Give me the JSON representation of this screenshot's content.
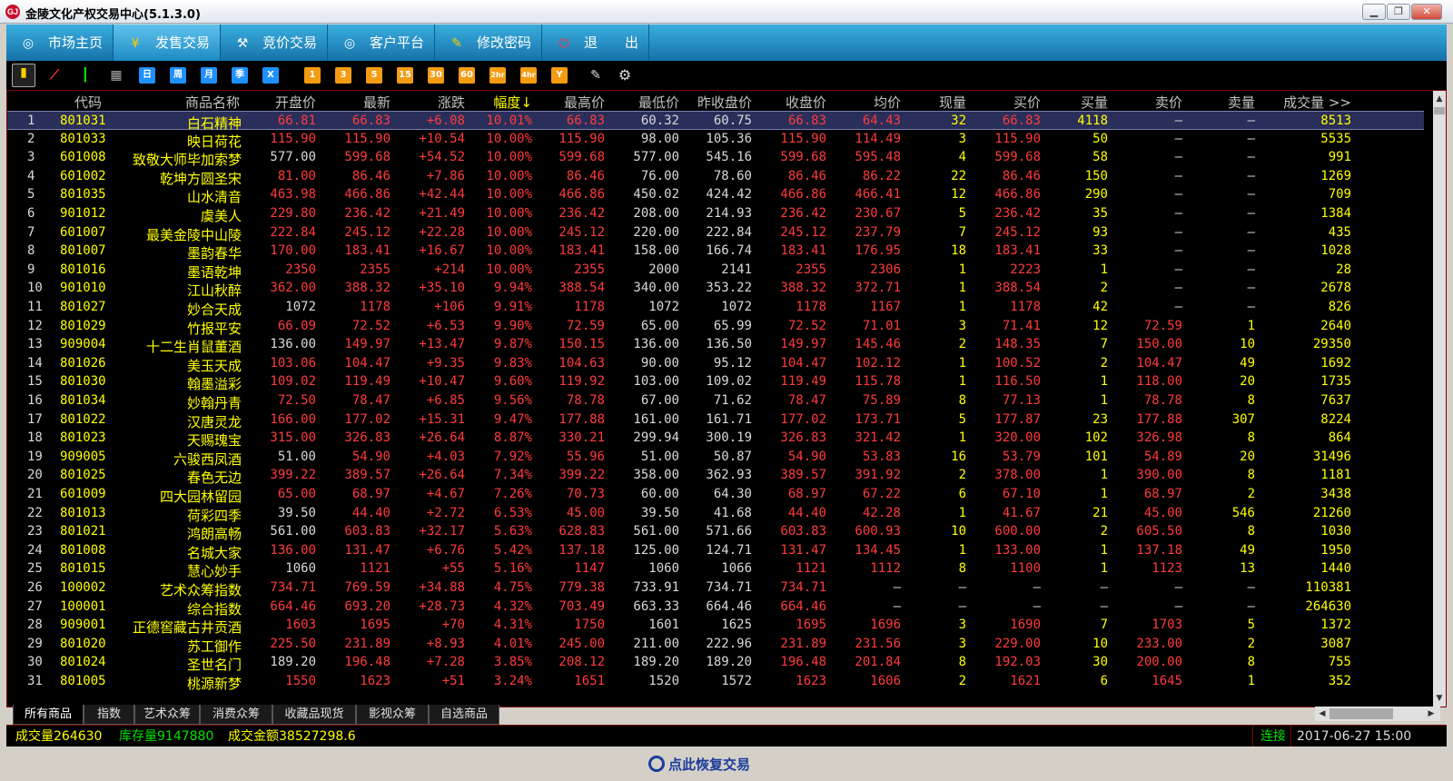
{
  "window": {
    "title": "金陵文化产权交易中心(5.1.3.0)",
    "logo": "GJ"
  },
  "nav": [
    {
      "label": "市场主页",
      "icon": "home-icon",
      "glyph": "◎"
    },
    {
      "label": "发售交易",
      "icon": "yuan-icon",
      "glyph": "¥"
    },
    {
      "label": "竞价交易",
      "icon": "auction-icon",
      "glyph": "⚒"
    },
    {
      "label": "客户平台",
      "icon": "client-icon",
      "glyph": "◎"
    },
    {
      "label": "修改密码",
      "icon": "key-icon",
      "glyph": "✎"
    },
    {
      "label": "退　　出",
      "icon": "power-icon",
      "glyph": "⏻"
    }
  ],
  "toolbar": {
    "periods": [
      "日",
      "周",
      "月",
      "季",
      "X"
    ],
    "minutes": [
      "1",
      "3",
      "5",
      "15",
      "30",
      "60",
      "2hr",
      "4hr",
      "Y"
    ]
  },
  "columns": [
    "代码",
    "商品名称",
    "开盘价",
    "最新",
    "涨跌",
    "幅度↓",
    "最高价",
    "最低价",
    "昨收盘价",
    "收盘价",
    "均价",
    "现量",
    "买价",
    "买量",
    "卖价",
    "卖量",
    "成交量 >>"
  ],
  "rows": [
    [
      "1",
      "801031",
      "白石精神",
      "66.81",
      "66.83",
      "+6.08",
      "10.01%",
      "66.83",
      "60.32",
      "60.75",
      "66.83",
      "64.43",
      "32",
      "66.83",
      "4118",
      "—",
      "—",
      "8513"
    ],
    [
      "2",
      "801033",
      "映日荷花",
      "115.90",
      "115.90",
      "+10.54",
      "10.00%",
      "115.90",
      "98.00",
      "105.36",
      "115.90",
      "114.49",
      "3",
      "115.90",
      "50",
      "—",
      "—",
      "5535"
    ],
    [
      "3",
      "601008",
      "致敬大师毕加索梦",
      "577.00",
      "599.68",
      "+54.52",
      "10.00%",
      "599.68",
      "577.00",
      "545.16",
      "599.68",
      "595.48",
      "4",
      "599.68",
      "58",
      "—",
      "—",
      "991"
    ],
    [
      "4",
      "601002",
      "乾坤方圆圣宋",
      "81.00",
      "86.46",
      "+7.86",
      "10.00%",
      "86.46",
      "76.00",
      "78.60",
      "86.46",
      "86.22",
      "22",
      "86.46",
      "150",
      "—",
      "—",
      "1269"
    ],
    [
      "5",
      "801035",
      "山水清音",
      "463.98",
      "466.86",
      "+42.44",
      "10.00%",
      "466.86",
      "450.02",
      "424.42",
      "466.86",
      "466.41",
      "12",
      "466.86",
      "290",
      "—",
      "—",
      "709"
    ],
    [
      "6",
      "901012",
      "虞美人",
      "229.80",
      "236.42",
      "+21.49",
      "10.00%",
      "236.42",
      "208.00",
      "214.93",
      "236.42",
      "230.67",
      "5",
      "236.42",
      "35",
      "—",
      "—",
      "1384"
    ],
    [
      "7",
      "601007",
      "最美金陵中山陵",
      "222.84",
      "245.12",
      "+22.28",
      "10.00%",
      "245.12",
      "220.00",
      "222.84",
      "245.12",
      "237.79",
      "7",
      "245.12",
      "93",
      "—",
      "—",
      "435"
    ],
    [
      "8",
      "801007",
      "墨韵春华",
      "170.00",
      "183.41",
      "+16.67",
      "10.00%",
      "183.41",
      "158.00",
      "166.74",
      "183.41",
      "176.95",
      "18",
      "183.41",
      "33",
      "—",
      "—",
      "1028"
    ],
    [
      "9",
      "801016",
      "墨语乾坤",
      "2350",
      "2355",
      "+214",
      "10.00%",
      "2355",
      "2000",
      "2141",
      "2355",
      "2306",
      "1",
      "2223",
      "1",
      "—",
      "—",
      "28"
    ],
    [
      "10",
      "901010",
      "江山秋醉",
      "362.00",
      "388.32",
      "+35.10",
      "9.94%",
      "388.54",
      "340.00",
      "353.22",
      "388.32",
      "372.71",
      "1",
      "388.54",
      "2",
      "—",
      "—",
      "2678"
    ],
    [
      "11",
      "801027",
      "妙合天成",
      "1072",
      "1178",
      "+106",
      "9.91%",
      "1178",
      "1072",
      "1072",
      "1178",
      "1167",
      "1",
      "1178",
      "42",
      "—",
      "—",
      "826"
    ],
    [
      "12",
      "801029",
      "竹报平安",
      "66.09",
      "72.52",
      "+6.53",
      "9.90%",
      "72.59",
      "65.00",
      "65.99",
      "72.52",
      "71.01",
      "3",
      "71.41",
      "12",
      "72.59",
      "1",
      "2640"
    ],
    [
      "13",
      "909004",
      "十二生肖鼠董酒",
      "136.00",
      "149.97",
      "+13.47",
      "9.87%",
      "150.15",
      "136.00",
      "136.50",
      "149.97",
      "145.46",
      "2",
      "148.35",
      "7",
      "150.00",
      "10",
      "29350"
    ],
    [
      "14",
      "801026",
      "美玉天成",
      "103.06",
      "104.47",
      "+9.35",
      "9.83%",
      "104.63",
      "90.00",
      "95.12",
      "104.47",
      "102.12",
      "1",
      "100.52",
      "2",
      "104.47",
      "49",
      "1692"
    ],
    [
      "15",
      "801030",
      "翰墨溢彩",
      "109.02",
      "119.49",
      "+10.47",
      "9.60%",
      "119.92",
      "103.00",
      "109.02",
      "119.49",
      "115.78",
      "1",
      "116.50",
      "1",
      "118.00",
      "20",
      "1735"
    ],
    [
      "16",
      "801034",
      "妙翰丹青",
      "72.50",
      "78.47",
      "+6.85",
      "9.56%",
      "78.78",
      "67.00",
      "71.62",
      "78.47",
      "75.89",
      "8",
      "77.13",
      "1",
      "78.78",
      "8",
      "7637"
    ],
    [
      "17",
      "801022",
      "汉唐灵龙",
      "166.00",
      "177.02",
      "+15.31",
      "9.47%",
      "177.88",
      "161.00",
      "161.71",
      "177.02",
      "173.71",
      "5",
      "177.87",
      "23",
      "177.88",
      "307",
      "8224"
    ],
    [
      "18",
      "801023",
      "天赐瑰宝",
      "315.00",
      "326.83",
      "+26.64",
      "8.87%",
      "330.21",
      "299.94",
      "300.19",
      "326.83",
      "321.42",
      "1",
      "320.00",
      "102",
      "326.98",
      "8",
      "864"
    ],
    [
      "19",
      "909005",
      "六骏西凤酒",
      "51.00",
      "54.90",
      "+4.03",
      "7.92%",
      "55.96",
      "51.00",
      "50.87",
      "54.90",
      "53.83",
      "16",
      "53.79",
      "101",
      "54.89",
      "20",
      "31496"
    ],
    [
      "20",
      "801025",
      "春色无边",
      "399.22",
      "389.57",
      "+26.64",
      "7.34%",
      "399.22",
      "358.00",
      "362.93",
      "389.57",
      "391.92",
      "2",
      "378.00",
      "1",
      "390.00",
      "8",
      "1181"
    ],
    [
      "21",
      "601009",
      "四大园林留园",
      "65.00",
      "68.97",
      "+4.67",
      "7.26%",
      "70.73",
      "60.00",
      "64.30",
      "68.97",
      "67.22",
      "6",
      "67.10",
      "1",
      "68.97",
      "2",
      "3438"
    ],
    [
      "22",
      "801013",
      "荷彩四季",
      "39.50",
      "44.40",
      "+2.72",
      "6.53%",
      "45.00",
      "39.50",
      "41.68",
      "44.40",
      "42.28",
      "1",
      "41.67",
      "21",
      "45.00",
      "546",
      "21260"
    ],
    [
      "23",
      "801021",
      "鸿朗高畅",
      "561.00",
      "603.83",
      "+32.17",
      "5.63%",
      "628.83",
      "561.00",
      "571.66",
      "603.83",
      "600.93",
      "10",
      "600.00",
      "2",
      "605.50",
      "8",
      "1030"
    ],
    [
      "24",
      "801008",
      "名城大家",
      "136.00",
      "131.47",
      "+6.76",
      "5.42%",
      "137.18",
      "125.00",
      "124.71",
      "131.47",
      "134.45",
      "1",
      "133.00",
      "1",
      "137.18",
      "49",
      "1950"
    ],
    [
      "25",
      "801015",
      "慧心妙手",
      "1060",
      "1121",
      "+55",
      "5.16%",
      "1147",
      "1060",
      "1066",
      "1121",
      "1112",
      "8",
      "1100",
      "1",
      "1123",
      "13",
      "1440"
    ],
    [
      "26",
      "100002",
      "艺术众筹指数",
      "734.71",
      "769.59",
      "+34.88",
      "4.75%",
      "779.38",
      "733.91",
      "734.71",
      "734.71",
      "—",
      "—",
      "—",
      "—",
      "—",
      "—",
      "110381"
    ],
    [
      "27",
      "100001",
      "综合指数",
      "664.46",
      "693.20",
      "+28.73",
      "4.32%",
      "703.49",
      "663.33",
      "664.46",
      "664.46",
      "—",
      "—",
      "—",
      "—",
      "—",
      "—",
      "264630"
    ],
    [
      "28",
      "909001",
      "正德窖藏古井贡酒",
      "1603",
      "1695",
      "+70",
      "4.31%",
      "1750",
      "1601",
      "1625",
      "1695",
      "1696",
      "3",
      "1690",
      "7",
      "1703",
      "5",
      "1372"
    ],
    [
      "29",
      "801020",
      "苏工御作",
      "225.50",
      "231.89",
      "+8.93",
      "4.01%",
      "245.00",
      "211.00",
      "222.96",
      "231.89",
      "231.56",
      "3",
      "229.00",
      "10",
      "233.00",
      "2",
      "3087"
    ],
    [
      "30",
      "801024",
      "圣世名门",
      "189.20",
      "196.48",
      "+7.28",
      "3.85%",
      "208.12",
      "189.20",
      "189.20",
      "196.48",
      "201.84",
      "8",
      "192.03",
      "30",
      "200.00",
      "8",
      "755"
    ],
    [
      "31",
      "801005",
      "桃源新梦",
      "1550",
      "1623",
      "+51",
      "3.24%",
      "1651",
      "1520",
      "1572",
      "1623",
      "1606",
      "2",
      "1621",
      "6",
      "1645",
      "1",
      "352"
    ]
  ],
  "tabs": [
    "所有商品",
    "指数",
    "艺术众筹",
    "消费众筹",
    "收藏品现货",
    "影视众筹",
    "自选商品"
  ],
  "status": {
    "volume": "成交量264630",
    "stock": "库存量9147880",
    "amount": "成交金额38527298.6",
    "conn": "连接",
    "time": "2017-06-27 15:00"
  },
  "restore": "点此恢复交易"
}
